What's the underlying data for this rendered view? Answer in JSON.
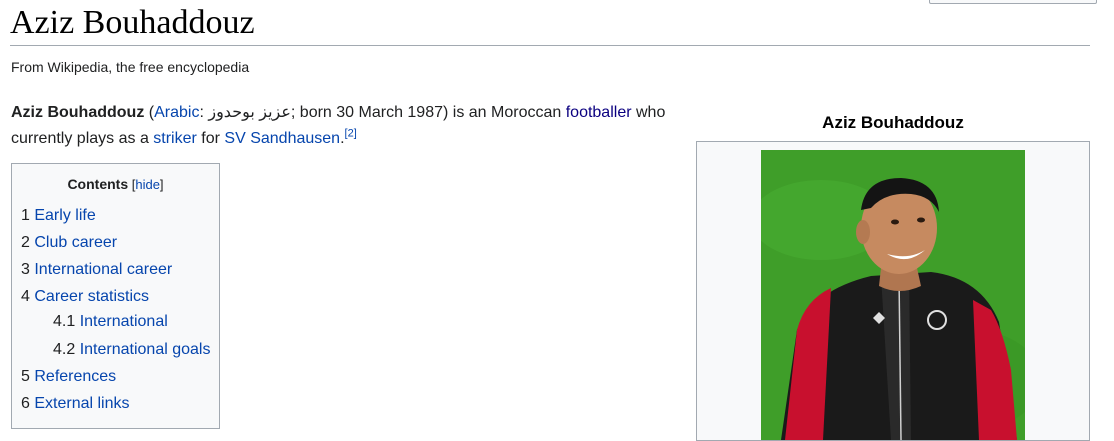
{
  "page": {
    "title": "Aziz Bouhaddouz",
    "tagline": "From Wikipedia, the free encyclopedia"
  },
  "lead": {
    "name": "Aziz Bouhaddouz",
    "open_paren": " (",
    "arabic_link": "Arabic",
    "arabic_text": ": عزيز بوحدوز",
    "born": "; born 30 March 1987) is an Moroccan ",
    "footballer_link": "footballer",
    "line2_a": " who currently plays as a ",
    "striker_link": "striker",
    "for": " for ",
    "club_link": "SV Sandhausen",
    "period": ".",
    "ref": "[2]"
  },
  "toc": {
    "title": "Contents",
    "hide_open": " [",
    "hide_label": "hide",
    "hide_close": "]",
    "items": [
      {
        "num": "1",
        "label": "Early life"
      },
      {
        "num": "2",
        "label": "Club career"
      },
      {
        "num": "3",
        "label": "International career"
      },
      {
        "num": "4",
        "label": "Career statistics"
      },
      {
        "num": "4.1",
        "label": "International"
      },
      {
        "num": "4.2",
        "label": "International goals"
      },
      {
        "num": "5",
        "label": "References"
      },
      {
        "num": "6",
        "label": "External links"
      }
    ]
  },
  "infobox": {
    "caption": "Aziz Bouhaddouz"
  },
  "colors": {
    "link": "#0645ad",
    "pitch_green": "#43a32c",
    "jacket_red": "#c8102e"
  }
}
